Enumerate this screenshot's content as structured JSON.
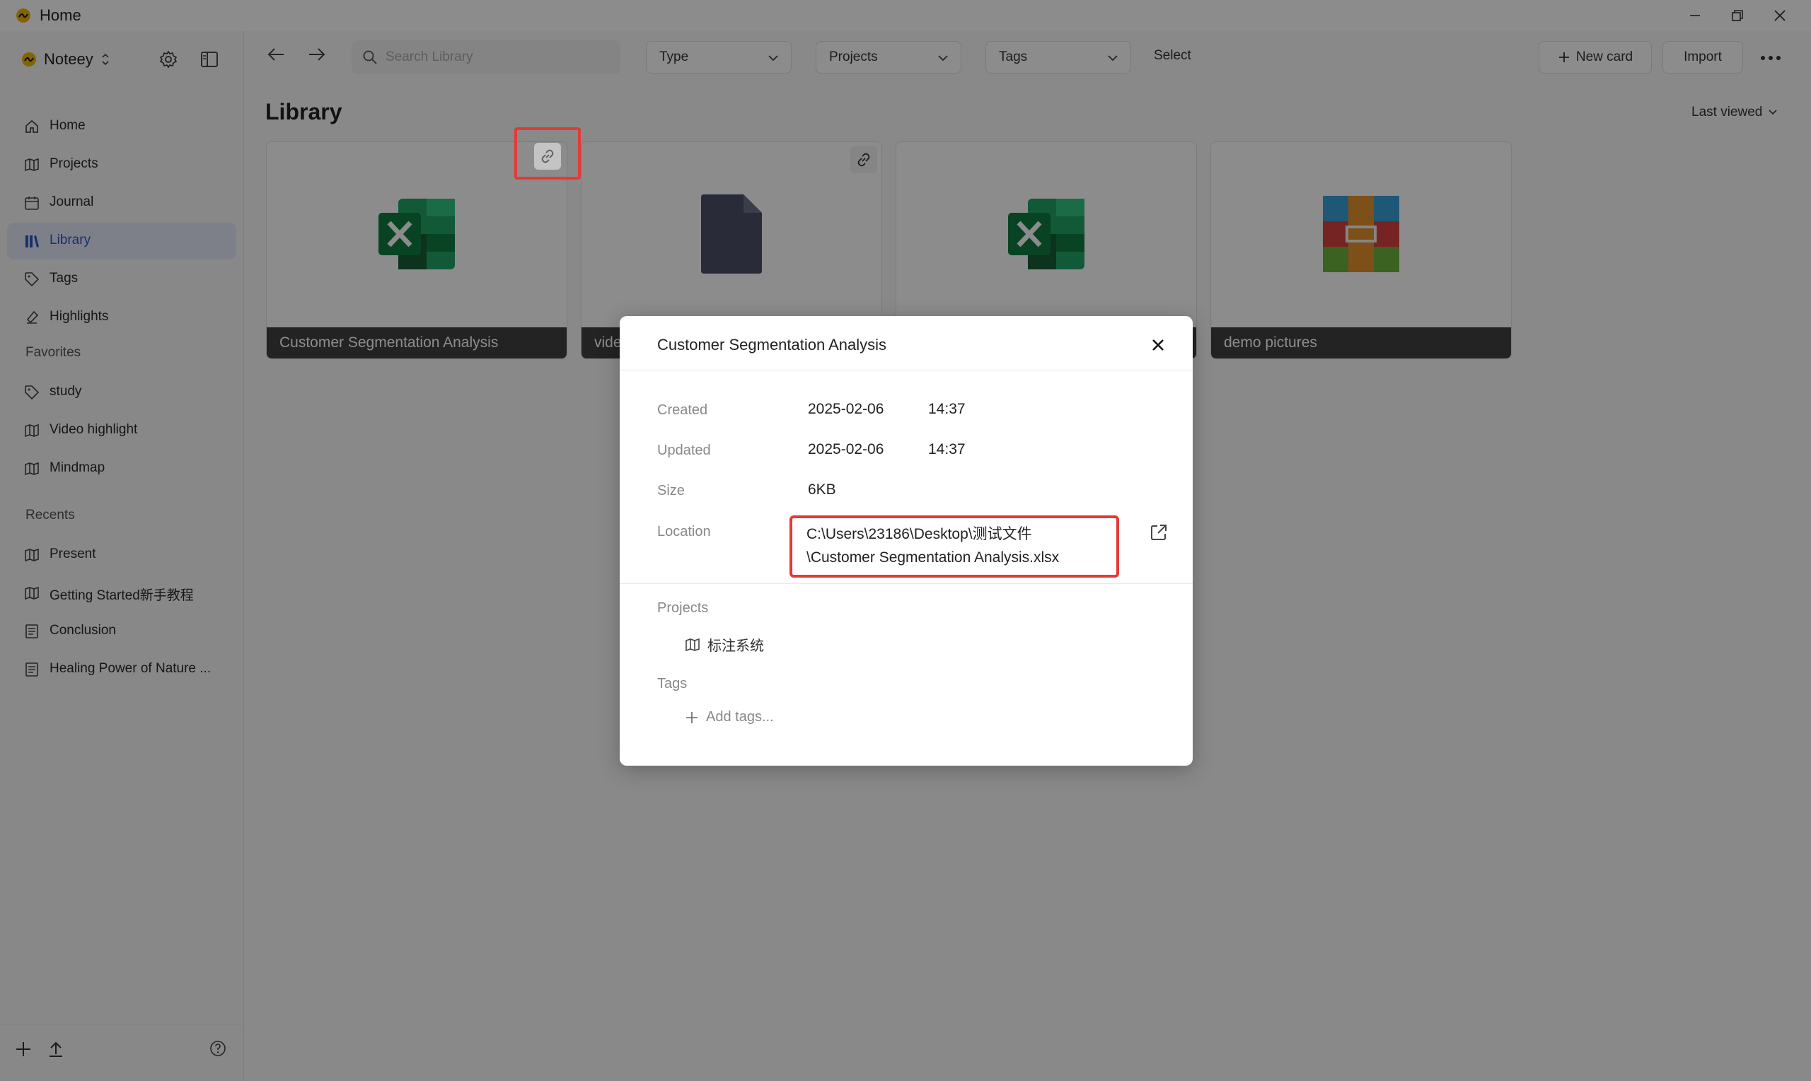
{
  "window": {
    "title": "Home",
    "controls": [
      "minimize",
      "restore",
      "close"
    ]
  },
  "sidebar": {
    "workspace": "Noteey",
    "nav": [
      {
        "label": "Home",
        "icon": "home-icon"
      },
      {
        "label": "Projects",
        "icon": "map-icon"
      },
      {
        "label": "Journal",
        "icon": "calendar-icon"
      },
      {
        "label": "Library",
        "icon": "library-icon",
        "active": true
      },
      {
        "label": "Tags",
        "icon": "tag-icon"
      },
      {
        "label": "Highlights",
        "icon": "highlighter-icon"
      }
    ],
    "favorites_title": "Favorites",
    "favorites": [
      {
        "label": "study",
        "icon": "tag-icon"
      },
      {
        "label": "Video highlight",
        "icon": "map-icon"
      },
      {
        "label": "Mindmap",
        "icon": "map-icon"
      }
    ],
    "recents_title": "Recents",
    "recents": [
      {
        "label": "Present",
        "icon": "map-icon"
      },
      {
        "label": "Getting Started新手教程",
        "icon": "map-icon"
      },
      {
        "label": "Conclusion",
        "icon": "document-icon"
      },
      {
        "label": "Healing Power of Nature ...",
        "icon": "document-icon"
      }
    ]
  },
  "toolbar": {
    "search_placeholder": "Search Library",
    "filters": [
      "Type",
      "Projects",
      "Tags"
    ],
    "select_label": "Select",
    "new_card_label": "New card",
    "import_label": "Import"
  },
  "library": {
    "title": "Library",
    "sort_label": "Last viewed",
    "cards": [
      {
        "label": "Customer Segmentation Analysis",
        "icon": "excel-icon",
        "link": true
      },
      {
        "label": "vide",
        "icon": "file-icon",
        "link": true
      },
      {
        "label": "",
        "icon": "excel-icon",
        "link": false
      },
      {
        "label": "demo pictures",
        "icon": "archive-icon",
        "link": false
      }
    ]
  },
  "modal": {
    "title": "Customer Segmentation Analysis",
    "created_label": "Created",
    "created_date": "2025-02-06",
    "created_time": "14:37",
    "updated_label": "Updated",
    "updated_date": "2025-02-06",
    "updated_time": "14:37",
    "size_label": "Size",
    "size_value": "6KB",
    "location_label": "Location",
    "location_line1": "C:\\Users\\23186\\Desktop\\测试文件",
    "location_line2": "\\Customer Segmentation Analysis.xlsx",
    "projects_label": "Projects",
    "project_name": "标注系统",
    "tags_label": "Tags",
    "add_tags_label": "Add tags..."
  },
  "colors": {
    "accent": "#2f58c9",
    "highlight": "#e53935",
    "excel_green": "#1f7244"
  }
}
